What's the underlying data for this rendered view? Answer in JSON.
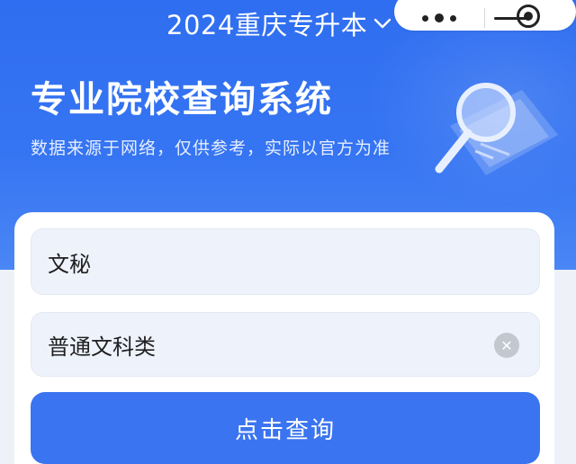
{
  "header": {
    "title": "2024重庆专升本",
    "dropdown_icon": "chevron-down-icon",
    "capsule": {
      "more_icon": "more-dots-icon",
      "minimize_icon": "minimize-icon",
      "close_icon": "close-target-icon"
    }
  },
  "hero": {
    "title": "专业院校查询系统",
    "subtitle": "数据来源于网络，仅供参考，实际以官方为准",
    "illustration_icon": "magnifier-icon"
  },
  "form": {
    "major_value": "文秘",
    "category_value": "普通文科类",
    "clear_icon": "clear-icon",
    "submit_label": "点击查询"
  },
  "colors": {
    "primary": "#3a74f0",
    "hero_top": "#2f6ef0",
    "field_bg": "#eef2fb"
  }
}
